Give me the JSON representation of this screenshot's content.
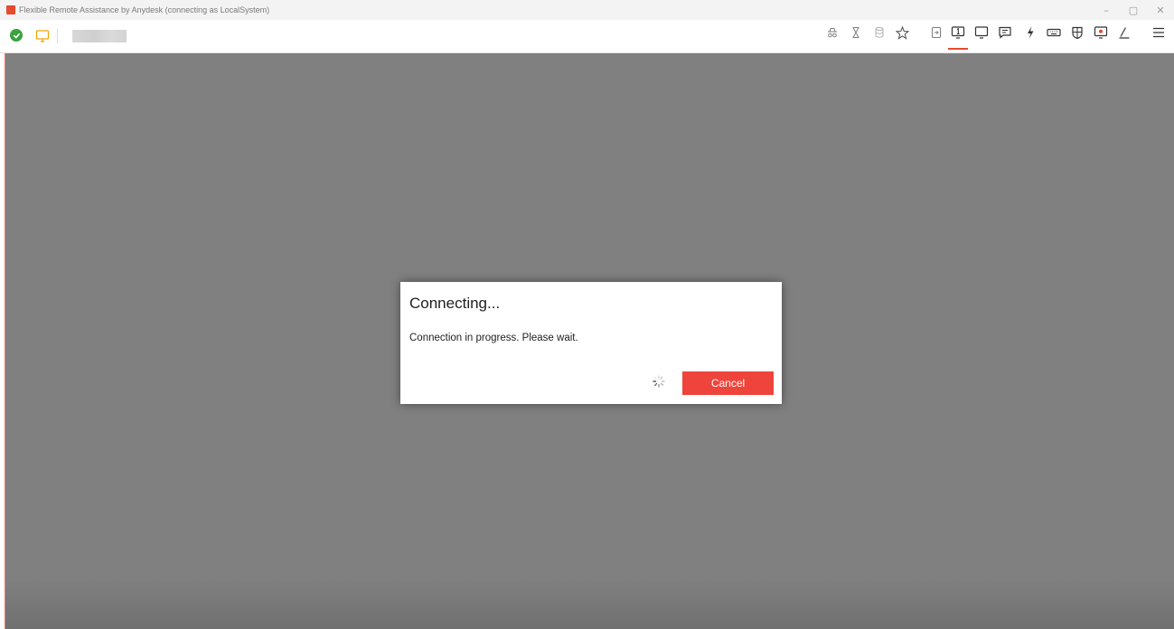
{
  "window": {
    "title": "Flexible Remote Assistance by Anydesk (connecting as LocalSystem)",
    "controls": {
      "minimize": "–",
      "restore": "▢",
      "close": "✕"
    }
  },
  "toolbar": {
    "status_icon": "check-circle-icon",
    "session_tab_icon": "monitor-icon",
    "session_id_redacted": "",
    "icons": [
      {
        "name": "spy-icon",
        "active": false
      },
      {
        "name": "hourglass-icon",
        "active": false
      },
      {
        "name": "database-icon",
        "active": false
      },
      {
        "name": "star-icon",
        "active": false
      },
      {
        "name": "file-transfer-icon",
        "active": false
      },
      {
        "name": "display-one-icon",
        "active": true
      },
      {
        "name": "monitor-icon",
        "active": false
      },
      {
        "name": "chat-icon",
        "active": false
      },
      {
        "name": "action-bolt-icon",
        "active": false
      },
      {
        "name": "keyboard-icon",
        "active": false
      },
      {
        "name": "privacy-shield-icon",
        "active": false
      },
      {
        "name": "record-icon",
        "active": false
      },
      {
        "name": "whiteboard-pen-icon",
        "active": false
      },
      {
        "name": "menu-icon",
        "active": false
      }
    ]
  },
  "dialog": {
    "title": "Connecting...",
    "message": "Connection in progress. Please wait.",
    "cancel_label": "Cancel"
  },
  "colors": {
    "accent": "#e8492f",
    "cancel_button": "#ef443b",
    "remote_background": "#808080",
    "status_ok": "#3aa33f",
    "monitor_tab": "#f0a800"
  }
}
